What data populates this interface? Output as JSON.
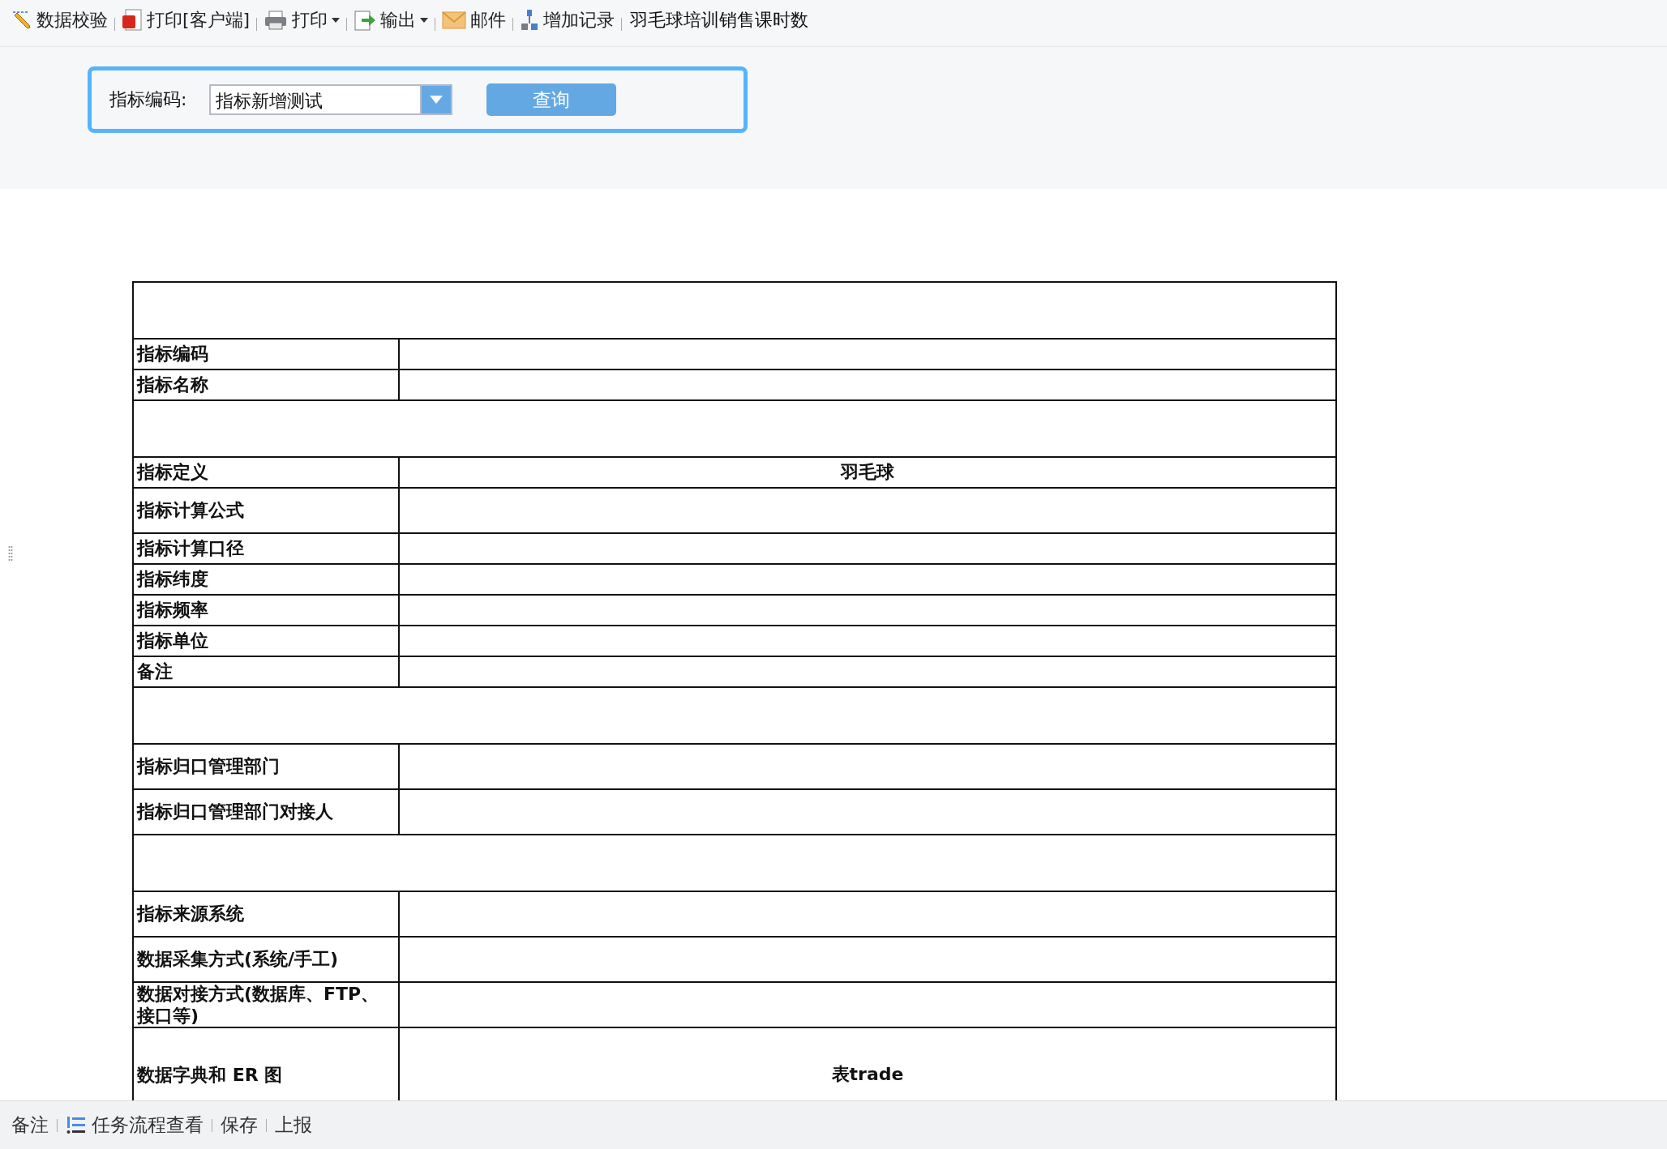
{
  "toolbar": [
    {
      "kind": "validate",
      "label": "数据校验",
      "has_menu": false
    },
    {
      "kind": "pdf",
      "label": "打印[客户端]",
      "has_menu": false
    },
    {
      "kind": "print",
      "label": "打印",
      "has_menu": true
    },
    {
      "kind": "export",
      "label": "输出",
      "has_menu": true
    },
    {
      "kind": "mail",
      "label": "邮件",
      "has_menu": false
    },
    {
      "kind": "add",
      "label": "增加记录",
      "has_menu": false
    },
    {
      "kind": "title",
      "label": "羽毛球培训销售课时数"
    }
  ],
  "query": {
    "label": "指标编码:",
    "value": "指标新增测试",
    "button": "查询"
  },
  "table": {
    "rows": [
      {
        "kind": "section"
      },
      {
        "kind": "field",
        "label": "指标编码"
      },
      {
        "kind": "field",
        "label": "指标名称"
      },
      {
        "kind": "section"
      },
      {
        "kind": "field",
        "label": "指标定义",
        "value": "羽毛球"
      },
      {
        "kind": "tall_field",
        "label": "指标计算公式"
      },
      {
        "kind": "field",
        "label": "指标计算口径"
      },
      {
        "kind": "field",
        "label": "指标纬度"
      },
      {
        "kind": "field",
        "label": "指标频率"
      },
      {
        "kind": "field",
        "label": "指标单位"
      },
      {
        "kind": "field",
        "label": "备注"
      },
      {
        "kind": "section"
      },
      {
        "kind": "tall_field",
        "label": "指标归口管理部门"
      },
      {
        "kind": "tall_field",
        "label": "指标归口管理部门对接人"
      },
      {
        "kind": "section"
      },
      {
        "kind": "tall_field",
        "label": "指标来源系统"
      },
      {
        "kind": "tall_field",
        "label": "数据采集方式(系统/手工)"
      },
      {
        "kind": "tall_field",
        "label": "数据对接方式(数据库、FTP、接口等)"
      },
      {
        "kind": "cut_field",
        "label": "数据字典和 ER 图",
        "value": "表trade"
      }
    ]
  },
  "bottom_bar": [
    {
      "kind": "text",
      "label": "备注"
    },
    {
      "kind": "flow",
      "label": "任务流程查看"
    },
    {
      "kind": "text",
      "label": "保存"
    },
    {
      "kind": "text",
      "label": "上报"
    }
  ]
}
